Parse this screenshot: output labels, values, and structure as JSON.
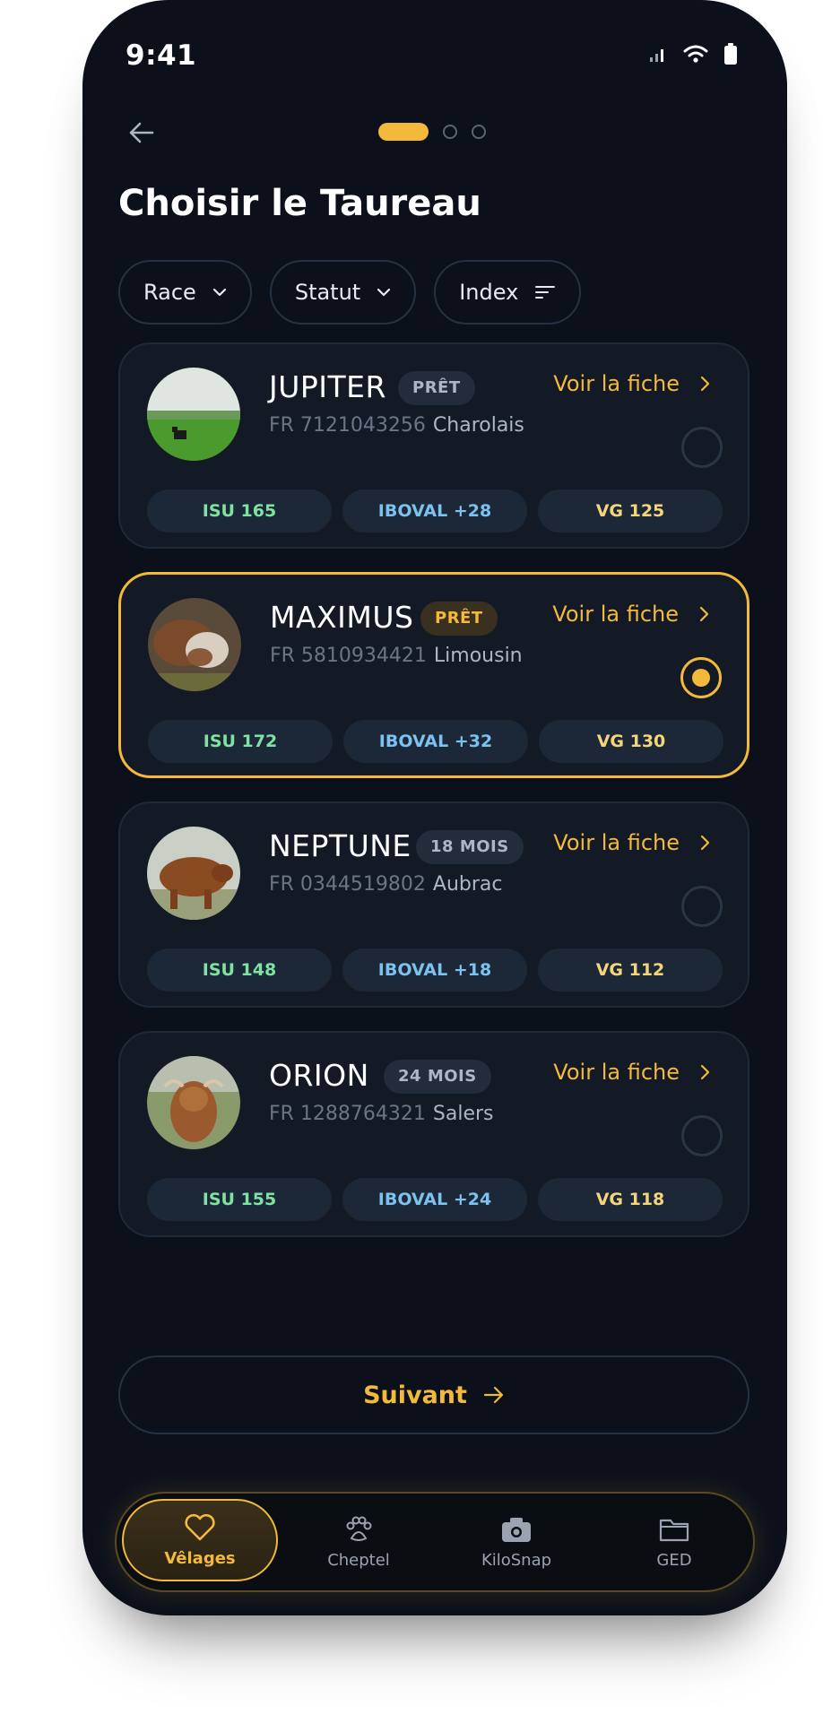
{
  "status_bar": {
    "time": "9:41"
  },
  "page": {
    "title": "Choisir le Taureau"
  },
  "filters": [
    {
      "label": "Race",
      "icon": "chevron-down-icon"
    },
    {
      "label": "Statut",
      "icon": "chevron-down-icon"
    },
    {
      "label": "Index",
      "icon": "sort-lines-icon"
    }
  ],
  "bulls": [
    {
      "name": "JUPITER",
      "badge": "PRÊT",
      "id": "FR 7121043256",
      "breed": "Charolais",
      "link": "Voir la fiche",
      "isu": "ISU 165",
      "iboval": "IBOVAL +28",
      "vg": "VG 125",
      "selected": false
    },
    {
      "name": "MAXIMUS",
      "badge": "PRÊT",
      "id": "FR 5810934421",
      "breed": "Limousin",
      "link": "Voir la fiche",
      "isu": "ISU 172",
      "iboval": "IBOVAL +32",
      "vg": "VG 130",
      "selected": true
    },
    {
      "name": "NEPTUNE",
      "badge": "18 MOIS",
      "id": "FR 0344519802",
      "breed": "Aubrac",
      "link": "Voir la fiche",
      "isu": "ISU 148",
      "iboval": "IBOVAL +18",
      "vg": "VG 112",
      "selected": false
    },
    {
      "name": "ORION",
      "badge": "24 MOIS",
      "id": "FR 1288764321",
      "breed": "Salers",
      "link": "Voir la fiche",
      "isu": "ISU 155",
      "iboval": "IBOVAL +24",
      "vg": "VG 118",
      "selected": false
    }
  ],
  "next_button": {
    "label": "Suivant"
  },
  "nav": [
    {
      "label": "Vêlages",
      "icon": "heart-icon",
      "active": true
    },
    {
      "label": "Cheptel",
      "icon": "paw-icon",
      "active": false
    },
    {
      "label": "KiloSnap",
      "icon": "camera-icon",
      "active": false
    },
    {
      "label": "GED",
      "icon": "folder-icon",
      "active": false
    }
  ],
  "colors": {
    "accent": "#f2b93b",
    "background": "#0b101a",
    "card": "#131a26",
    "isu": "#7ee3a0",
    "iboval": "#7cc2f0",
    "vg": "#f5d57a"
  }
}
